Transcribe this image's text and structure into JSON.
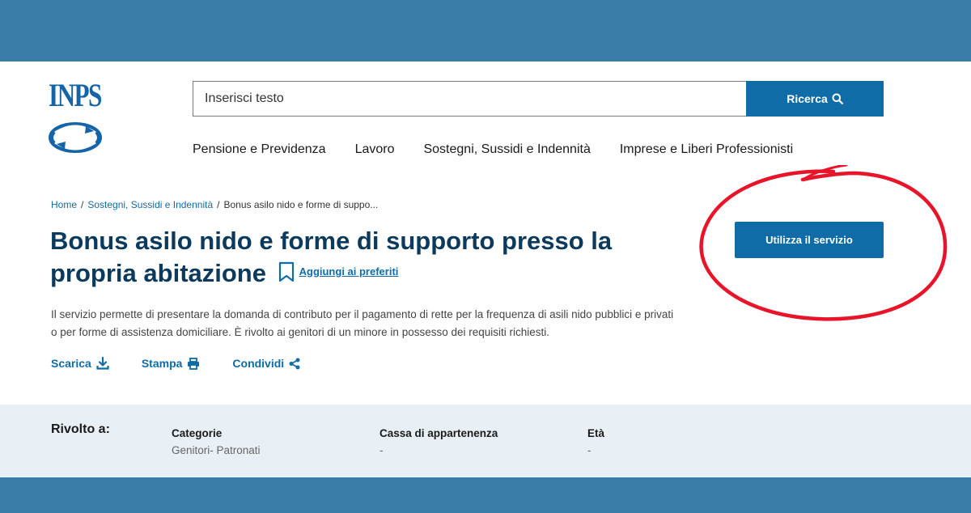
{
  "logo": {
    "text": "INPS"
  },
  "search": {
    "placeholder": "Inserisci testo",
    "button_label": "Ricerca"
  },
  "nav": {
    "items": [
      {
        "label": "Pensione e Previdenza"
      },
      {
        "label": "Lavoro"
      },
      {
        "label": "Sostegni, Sussidi e Indennità"
      },
      {
        "label": "Imprese e Liberi Professionisti"
      }
    ]
  },
  "breadcrumb": {
    "home": "Home",
    "section": "Sostegni, Sussidi e Indennità",
    "current": "Bonus asilo nido e forme di suppo...",
    "separator": "/"
  },
  "page": {
    "title": "Bonus asilo nido e forme di supporto presso la propria abitazione",
    "favorite_label": "Aggiungi ai preferiti",
    "description": "Il servizio permette di presentare la domanda di contributo per il pagamento di rette per la frequenza di asili nido pubblici e privati o per forme di assistenza domiciliare. È rivolto ai genitori di un minore in possesso dei requisiti richiesti.",
    "use_service_label": "Utilizza il servizio"
  },
  "actions": {
    "download": "Scarica",
    "print": "Stampa",
    "share": "Condividi"
  },
  "info": {
    "heading": "Rivolto a:",
    "categories_label": "Categorie",
    "categories_value": "Genitori- Patronati",
    "cassa_label": "Cassa di appartenenza",
    "cassa_value": "-",
    "eta_label": "Età",
    "eta_value": "-"
  },
  "colors": {
    "band": "#3a7ea8",
    "primary": "#0f6ca6",
    "title": "#0b3a5d",
    "info_bg": "#e8f0f5",
    "annotation": "#e8142a"
  }
}
